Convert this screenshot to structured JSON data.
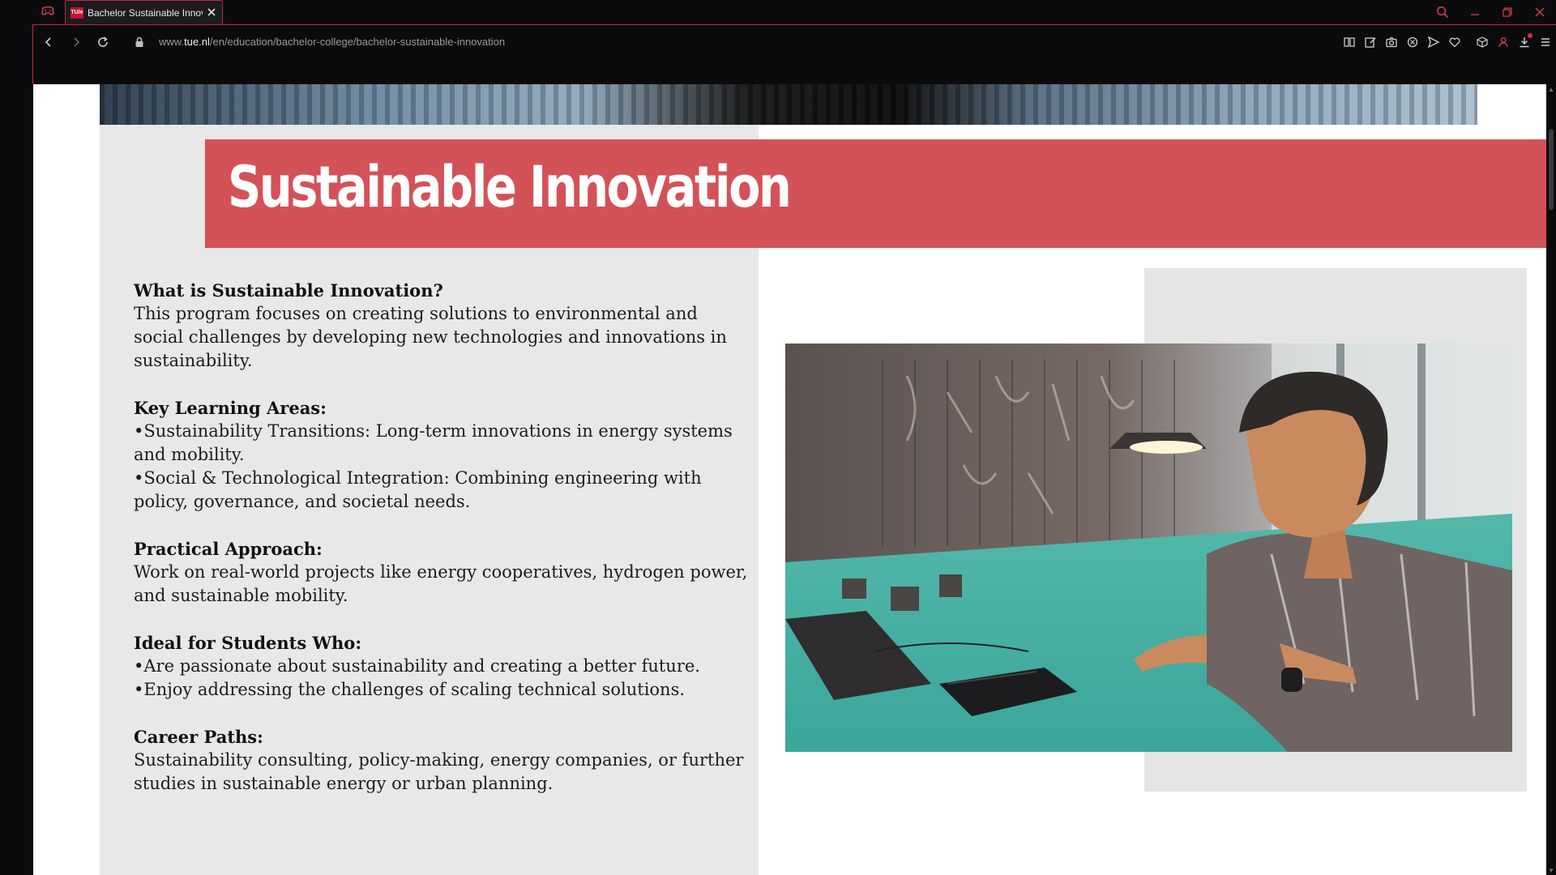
{
  "browser": {
    "tab_title": "Bachelor Sustainable Innov",
    "tab_favicon_text": "TU/e",
    "url_prefix": "www.",
    "url_host": "tue.nl",
    "url_path": "/en/education/bachelor-college/bachelor-sustainable-innovation",
    "accent_color": "#c5263a"
  },
  "page": {
    "title": "Sustainable Innovation",
    "title_band_color": "#d35258",
    "sections": [
      {
        "heading": "What is Sustainable Innovation?",
        "lines": [
          "This program focuses on creating solutions to environmental and social challenges by developing new technologies and innovations in sustainability."
        ]
      },
      {
        "heading": "Key Learning Areas:",
        "lines": [
          "•Sustainability Transitions: Long-term innovations in energy systems and mobility.",
          "•Social & Technological Integration: Combining engineering with policy, governance, and societal needs."
        ]
      },
      {
        "heading": "Practical Approach:",
        "lines": [
          "Work on real-world projects like energy cooperatives, hydrogen power, and sustainable mobility."
        ]
      },
      {
        "heading": "Ideal for Students Who:",
        "lines": [
          "•Are passionate about sustainability and creating a better future.",
          "•Enjoy addressing the challenges of scaling technical solutions."
        ]
      },
      {
        "heading": "Career Paths:",
        "lines": [
          "Sustainability consulting, policy-making, energy companies, or further studies in sustainable energy or urban planning."
        ]
      }
    ]
  }
}
